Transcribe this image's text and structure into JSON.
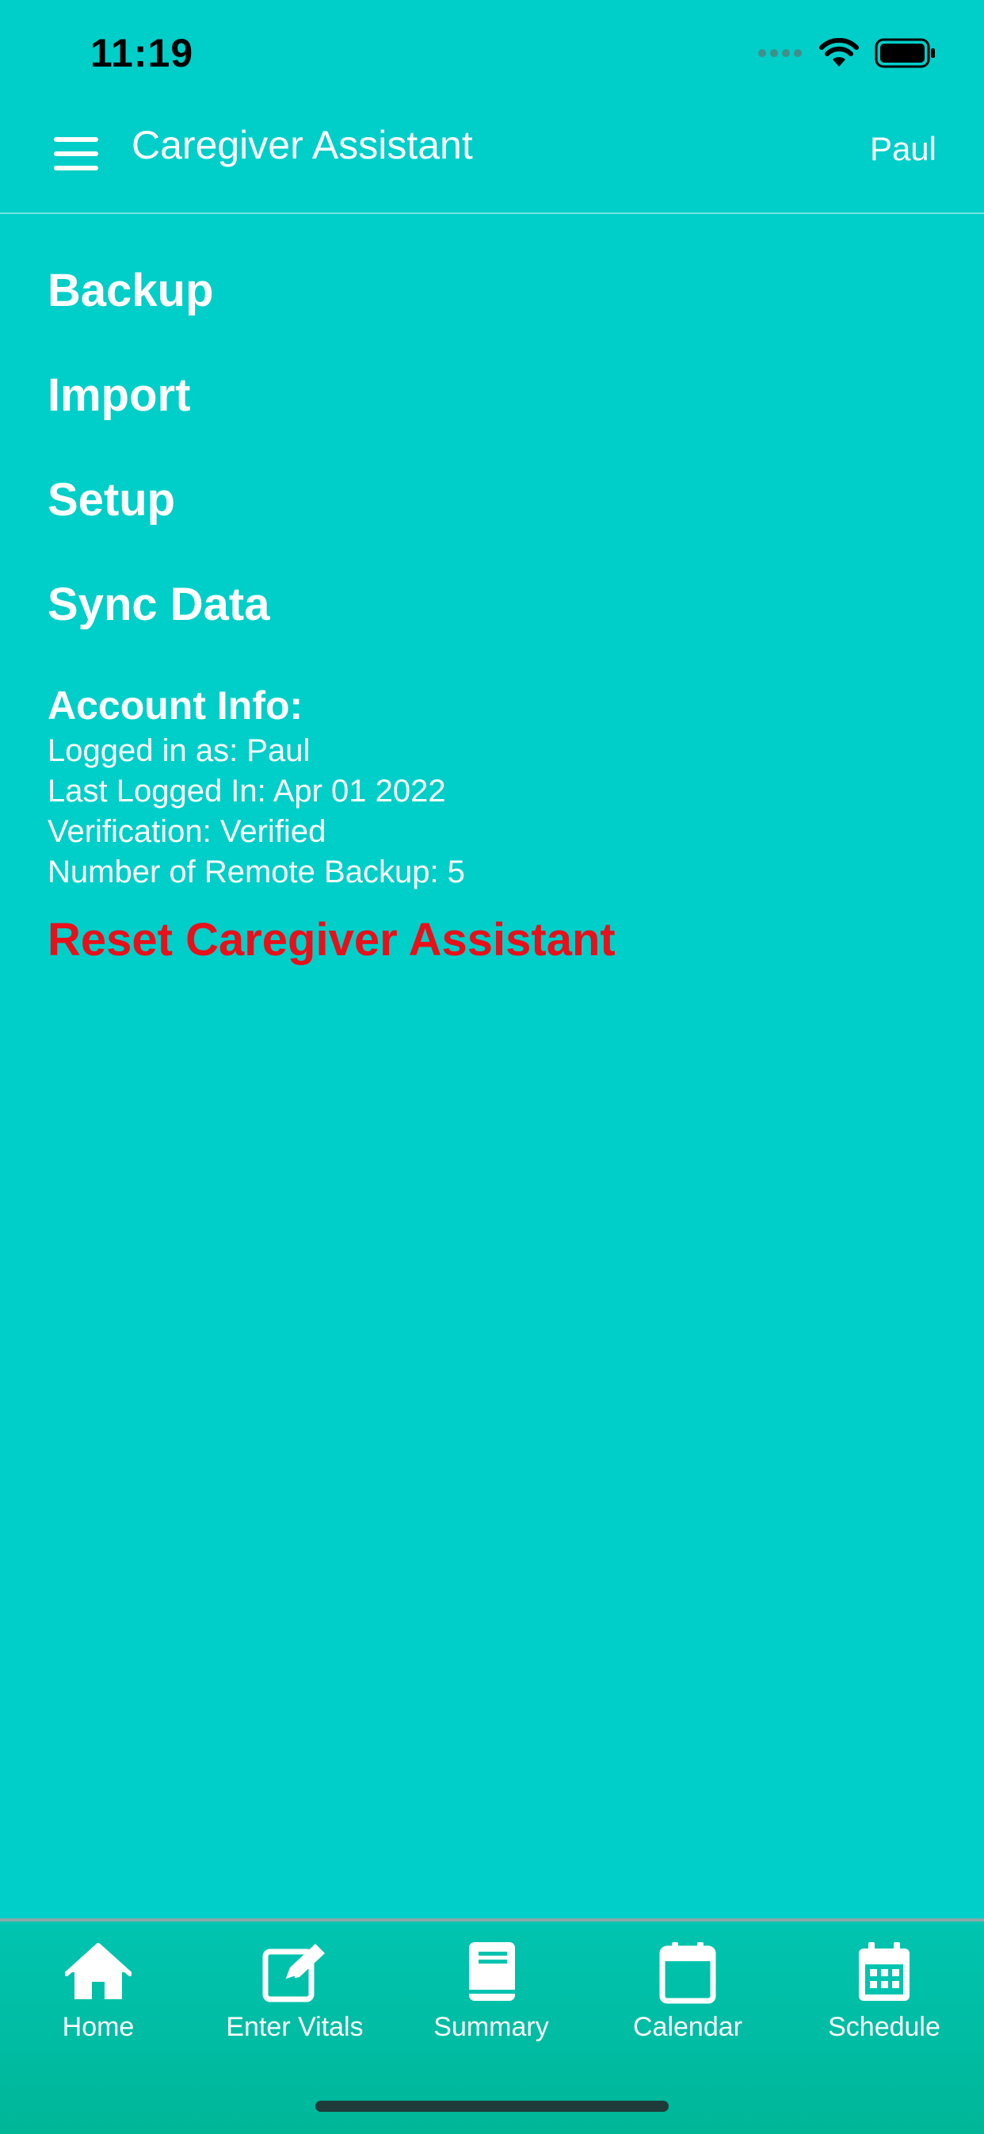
{
  "status_bar": {
    "time": "11:19"
  },
  "header": {
    "title": "Caregiver Assistant",
    "user": "Paul"
  },
  "menu": {
    "items": [
      "Backup",
      "Import",
      "Setup",
      "Sync Data"
    ]
  },
  "account": {
    "title": "Account Info:",
    "logged_in_as": "Logged in as: Paul",
    "last_logged_in": "Last Logged In: Apr 01 2022",
    "verification": "Verification: Verified",
    "remote_backups": "Number of Remote Backup: 5"
  },
  "reset_label": "Reset Caregiver Assistant",
  "tabs": [
    {
      "label": "Home",
      "icon": "home-icon"
    },
    {
      "label": "Enter Vitals",
      "icon": "edit-icon"
    },
    {
      "label": "Summary",
      "icon": "book-icon"
    },
    {
      "label": "Calendar",
      "icon": "calendar-icon"
    },
    {
      "label": "Schedule",
      "icon": "schedule-icon"
    }
  ],
  "colors": {
    "background": "#00CEC8",
    "tab_bar": "#00BDA4",
    "danger": "#E8101A"
  }
}
